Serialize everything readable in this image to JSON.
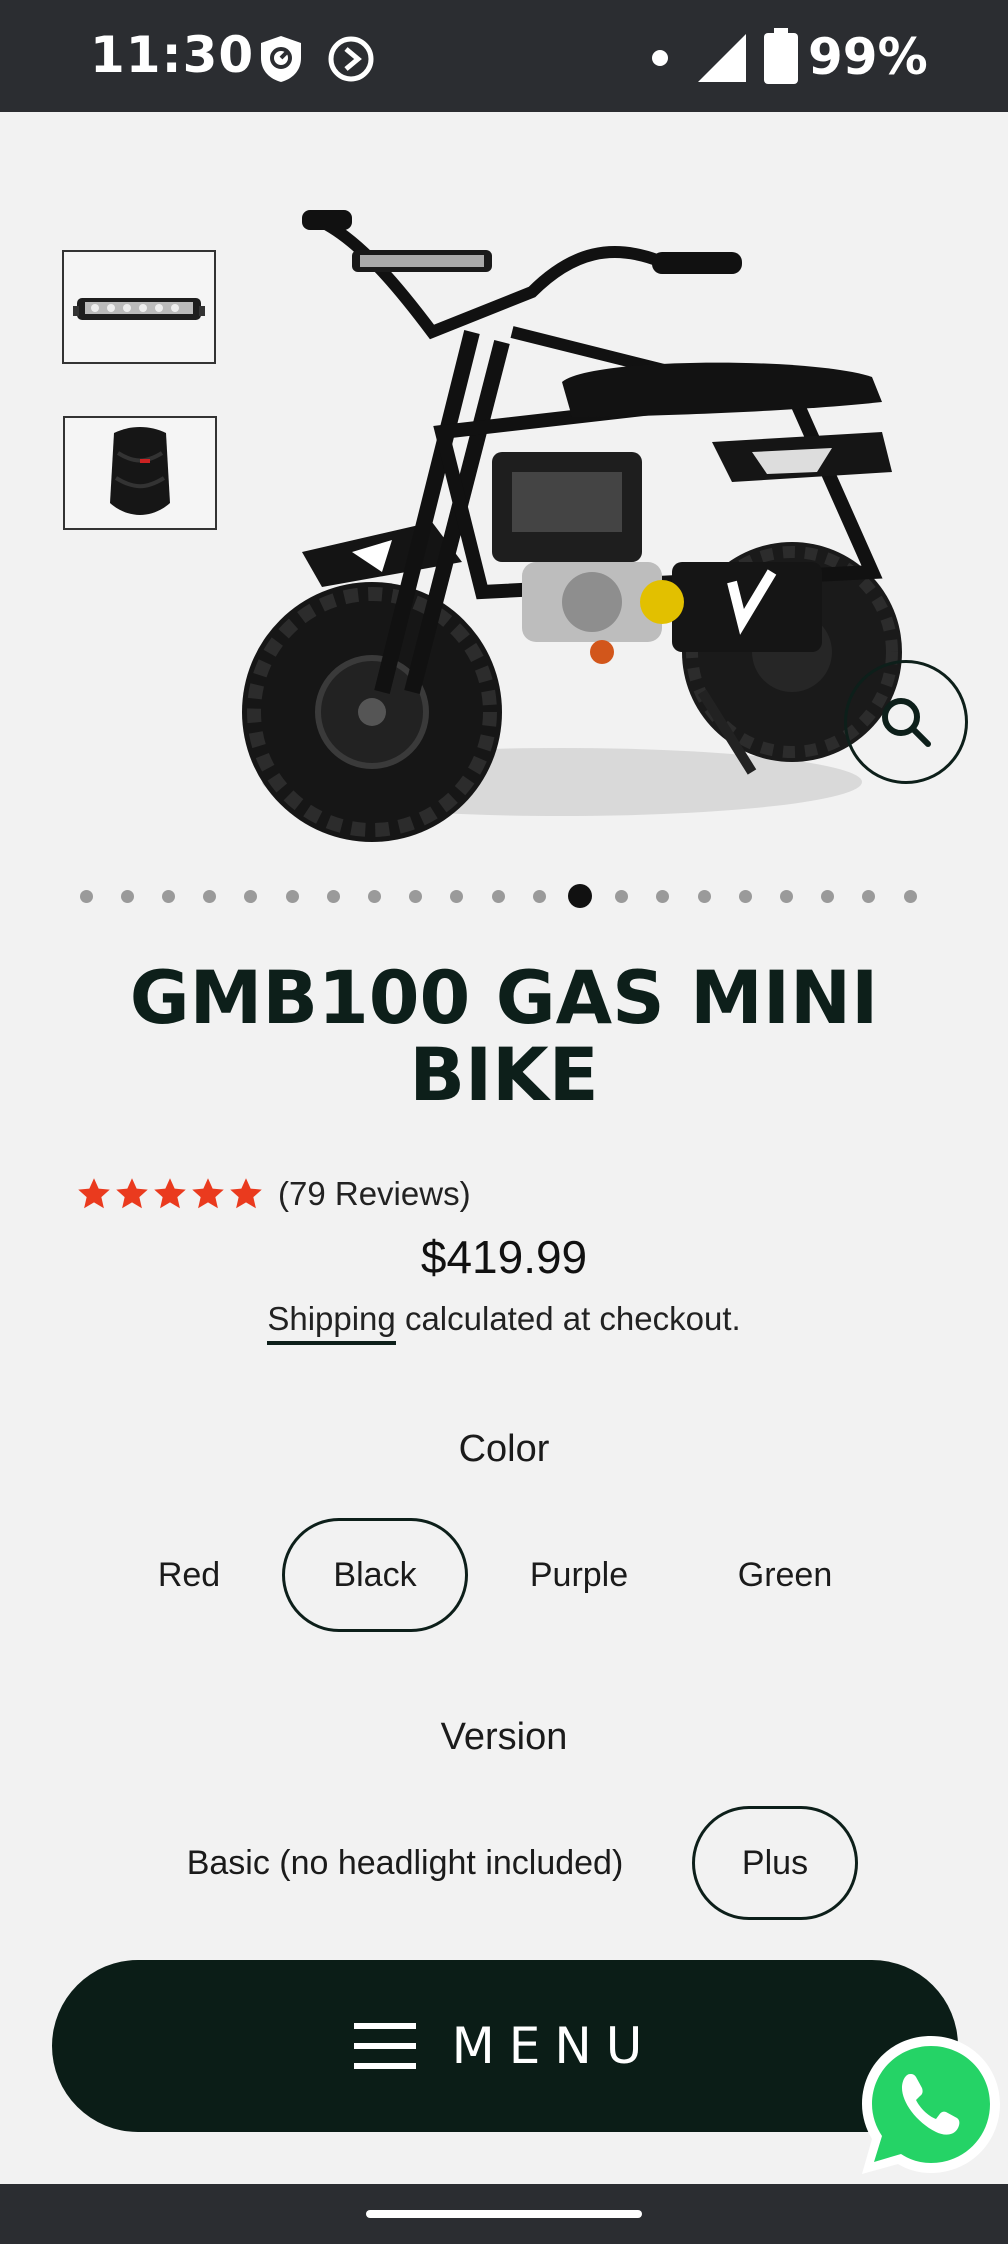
{
  "status_bar": {
    "time": "11:30",
    "battery_percent": "99%",
    "icons": [
      "shield-icon",
      "sync-icon",
      "dot-icon",
      "signal-icon",
      "battery-icon"
    ]
  },
  "gallery": {
    "thumbnails": [
      {
        "name": "led-light-bar-thumbnail"
      },
      {
        "name": "neck-gaiter-thumbnail"
      }
    ],
    "main_image_alt": "mini-bike-image",
    "slide_count": 21,
    "active_slide": 13
  },
  "product": {
    "title": "GMB100 GAS MINI BIKE",
    "rating_stars": 5,
    "reviews_text": "(79 Reviews)",
    "price": "$419.99",
    "shipping_link": "Shipping",
    "shipping_rest": " calculated at checkout."
  },
  "options": {
    "color": {
      "label": "Color",
      "values": [
        "Red",
        "Black",
        "Purple",
        "Green"
      ],
      "selected": "Black"
    },
    "version": {
      "label": "Version",
      "values": [
        "Basic (no headlight included)",
        "Plus"
      ],
      "selected": "Plus"
    }
  },
  "menu": {
    "label": "MENU"
  },
  "colors": {
    "accent": "#0b1d17",
    "star": "#ea3a1e",
    "whatsapp": "#25d366"
  }
}
